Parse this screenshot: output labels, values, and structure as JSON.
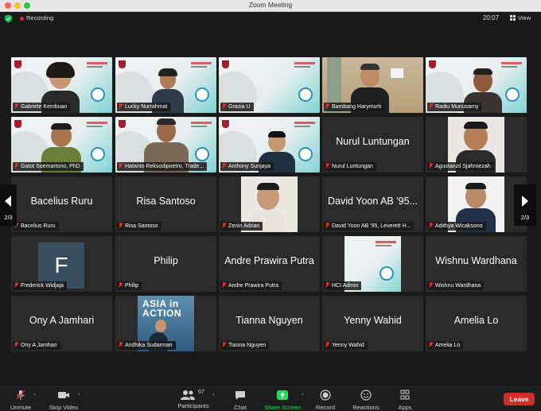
{
  "window": {
    "title": "Zoom Meeting"
  },
  "topbar": {
    "recording_label": "Recording",
    "clock": "20:07",
    "view_label": "View"
  },
  "pagination": {
    "left_page": "2/3",
    "right_page": "2/3"
  },
  "tiles": [
    {
      "name": "Gabriele Kembuan",
      "big": ""
    },
    {
      "name": "Lucky Nurrahmat",
      "big": ""
    },
    {
      "name": "Grazia U",
      "big": ""
    },
    {
      "name": "Bambang Harymurti",
      "big": ""
    },
    {
      "name": "Radiu Munusamy",
      "big": ""
    },
    {
      "name": "Gatot Soemartono, PhD",
      "big": ""
    },
    {
      "name": "Hatanto Reksodipoetro, Trade...",
      "big": ""
    },
    {
      "name": "Anthony Sunjaya",
      "big": ""
    },
    {
      "name": "Nurul Luntungan",
      "big": "Nurul Luntungan"
    },
    {
      "name": "Agustanzil Sjahroezah",
      "big": ""
    },
    {
      "name": "Bacelius Ruru",
      "big": "Bacelius Ruru"
    },
    {
      "name": "Risa Santoso",
      "big": "Risa Santoso"
    },
    {
      "name": "Zenin Adrian",
      "big": ""
    },
    {
      "name": "David Yoon AB '95, Leverett H...",
      "big": "David Yoon AB '95..."
    },
    {
      "name": "Adithya Wicaksono",
      "big": ""
    },
    {
      "name": "Frederick Widjaja",
      "big": "",
      "avatar_letter": "F"
    },
    {
      "name": "Philip",
      "big": "Philip"
    },
    {
      "name": "Andre Prawira Putra",
      "big": "Andre Prawira Putra"
    },
    {
      "name": "HCI Admin",
      "big": ""
    },
    {
      "name": "Wishnu Wardhana",
      "big": "Wishnu Wardhana"
    },
    {
      "name": "Ony A Jamhari",
      "big": "Ony A Jamhari"
    },
    {
      "name": "Andhika Sudarman",
      "big": "",
      "banner": "ASIA in\nACTION"
    },
    {
      "name": "Tianna Nguyen",
      "big": "Tianna Nguyen"
    },
    {
      "name": "Yenny Wahid",
      "big": "Yenny Wahid"
    },
    {
      "name": "Amelia Lo",
      "big": "Amelia Lo"
    }
  ],
  "toolbar": {
    "unmute": "Unmute",
    "stop_video": "Stop Video",
    "participants": "Participants",
    "participants_count": "67",
    "chat": "Chat",
    "share_screen": "Share Screen",
    "record": "Record",
    "reactions": "Reactions",
    "apps": "Apps",
    "leave": "Leave"
  },
  "colors": {
    "leave": "#d52b26",
    "share_screen": "#23d959",
    "muted_mic": "#e0302a"
  }
}
